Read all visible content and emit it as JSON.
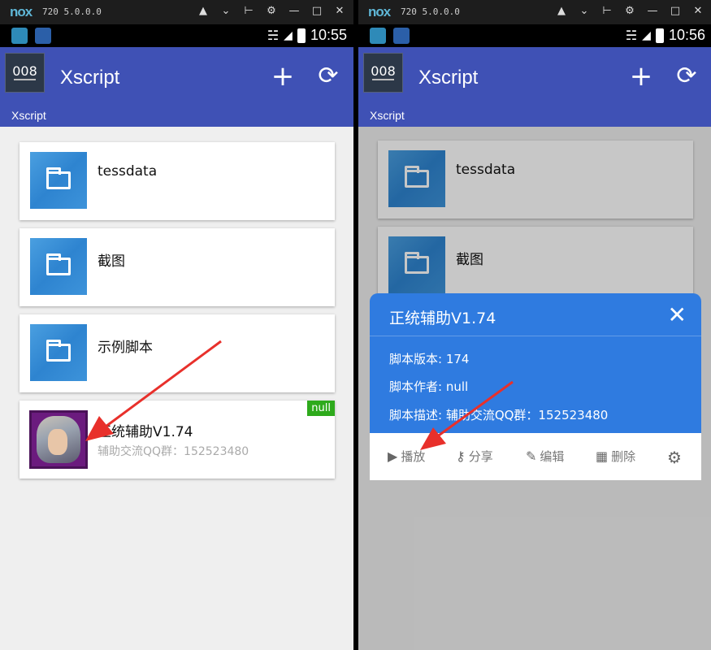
{
  "emulator": {
    "logo": "nox",
    "version": "720 5.0.0.0",
    "controls": [
      "shirt-icon",
      "chevron-down-icon",
      "pin-icon",
      "gear-icon",
      "minimize-icon",
      "maximize-icon",
      "close-icon"
    ]
  },
  "left": {
    "status_time": "10:55",
    "app": {
      "icon_text": "008",
      "title": "Xscript",
      "breadcrumb": "Xscript"
    },
    "folders": [
      {
        "name": "tessdata"
      },
      {
        "name": "截图"
      },
      {
        "name": "示例脚本"
      }
    ],
    "script": {
      "title": "正统辅助V1.74",
      "description": "辅助交流QQ群：152523480",
      "badge": "null"
    }
  },
  "right": {
    "status_time": "10:56",
    "app": {
      "icon_text": "008",
      "title": "Xscript",
      "breadcrumb": "Xscript"
    },
    "folders": [
      {
        "name": "tessdata"
      },
      {
        "name": "截图"
      }
    ],
    "dialog": {
      "title": "正统辅助V1.74",
      "version_line": "脚本版本: 174",
      "author_line": "脚本作者: null",
      "desc_line": "脚本描述: 辅助交流QQ群：152523480",
      "actions": {
        "play": "播放",
        "share": "分享",
        "edit": "编辑",
        "delete": "删除"
      }
    }
  },
  "colors": {
    "toolbar": "#3f51b5",
    "dialog_header": "#2f7be0",
    "badge": "#2eaa1c",
    "arrow": "#e8302b"
  }
}
